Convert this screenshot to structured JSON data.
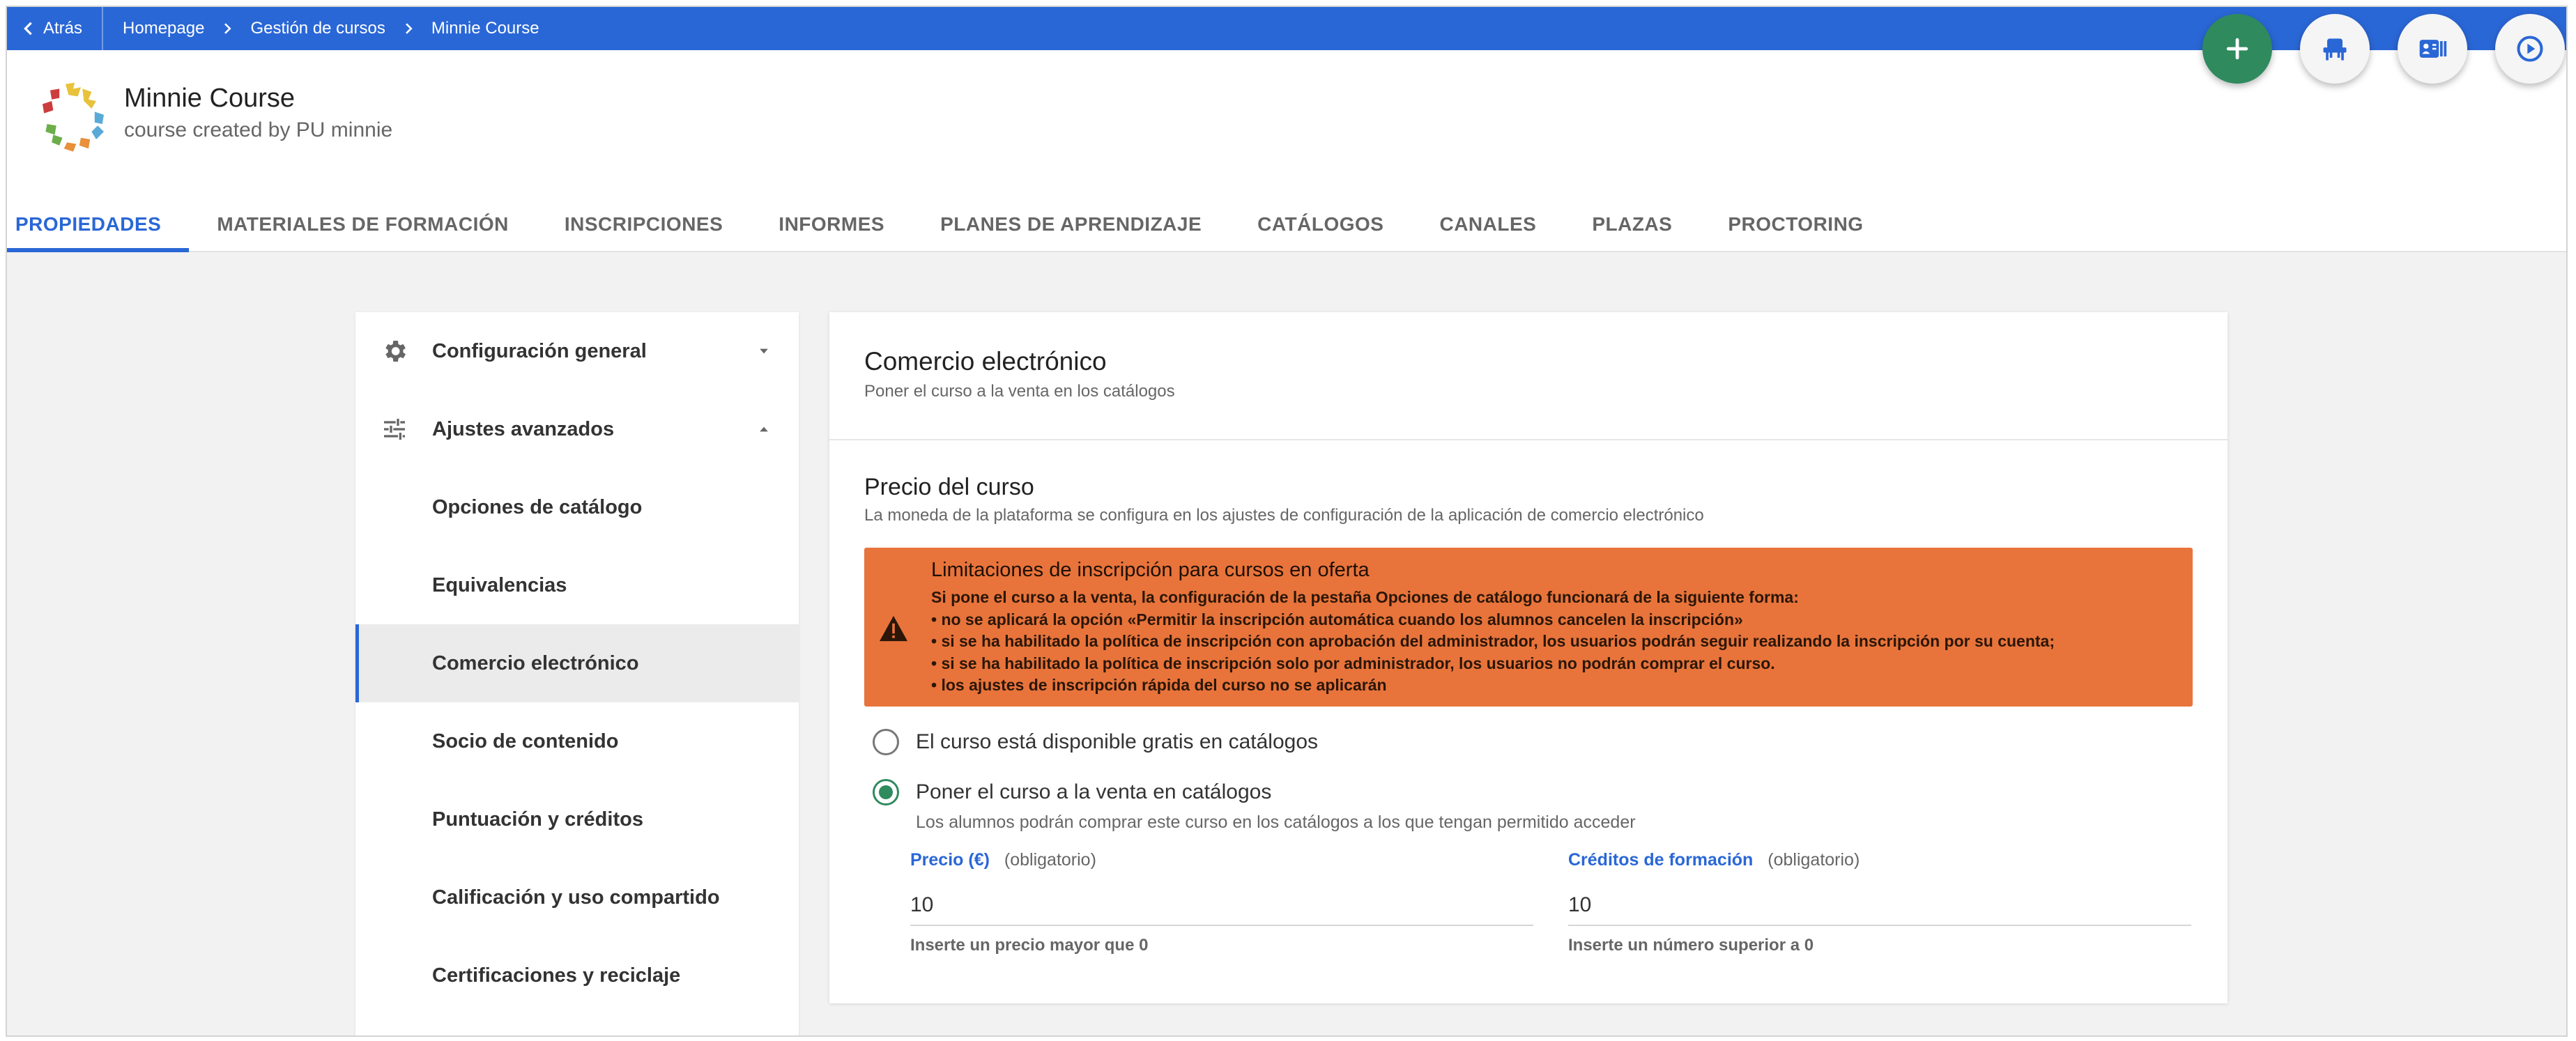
{
  "topbar": {
    "back_label": "Atrás",
    "breadcrumb": [
      "Homepage",
      "Gestión de cursos",
      "Minnie Course"
    ]
  },
  "course": {
    "title": "Minnie Course",
    "subtitle": "course created by PU minnie"
  },
  "colors": {
    "primary": "#2a67d6",
    "success": "#2f8a5e",
    "warning": "#e8743b"
  },
  "fabs": [
    {
      "icon": "plus-icon"
    },
    {
      "icon": "seat-icon"
    },
    {
      "icon": "id-card-icon"
    },
    {
      "icon": "play-circle-icon"
    }
  ],
  "tabs": [
    {
      "label": "PROPIEDADES",
      "active": true
    },
    {
      "label": "MATERIALES DE FORMACIÓN"
    },
    {
      "label": "INSCRIPCIONES"
    },
    {
      "label": "INFORMES"
    },
    {
      "label": "PLANES DE APRENDIZAJE"
    },
    {
      "label": "CATÁLOGOS"
    },
    {
      "label": "CANALES"
    },
    {
      "label": "PLAZAS"
    },
    {
      "label": "PROCTORING"
    }
  ],
  "sidebar": {
    "items": [
      {
        "label": "Configuración general",
        "icon": "gear-icon",
        "chevron": "down"
      },
      {
        "label": "Ajustes avanzados",
        "icon": "sliders-icon",
        "chevron": "up"
      },
      {
        "label": "Opciones de catálogo"
      },
      {
        "label": "Equivalencias"
      },
      {
        "label": "Comercio electrónico",
        "active": true
      },
      {
        "label": "Socio de contenido"
      },
      {
        "label": "Puntuación y créditos"
      },
      {
        "label": "Calificación y uso compartido"
      },
      {
        "label": "Certificaciones y reciclaje"
      }
    ]
  },
  "main": {
    "title": "Comercio electrónico",
    "subtitle": "Poner el curso a la venta en los catálogos",
    "price_section": {
      "title": "Precio del curso",
      "subtitle": "La moneda de la plataforma se configura en los ajustes de configuración de la aplicación de comercio electrónico"
    },
    "warning": {
      "title": "Limitaciones de inscripción para cursos en oferta",
      "lines": [
        "Si pone el curso a la venta, la configuración de la pestaña Opciones de catálogo funcionará de la siguiente forma:",
        "• no se aplicará la opción «Permitir la inscripción automática cuando los alumnos cancelen la inscripción»",
        "• si se ha habilitado la política de inscripción con aprobación del administrador, los usuarios podrán seguir realizando la inscripción por su cuenta;",
        "• si se ha habilitado la política de inscripción solo por administrador, los usuarios no podrán comprar el curso.",
        "• los ajustes de inscripción rápida del curso no se aplicarán"
      ]
    },
    "options": {
      "free_label": "El curso está disponible gratis en catálogos",
      "sale_label": "Poner el curso a la venta en catálogos",
      "sale_description": "Los alumnos podrán comprar este curso en los catálogos a los que tengan permitido acceder",
      "selected": "sale"
    },
    "price_field": {
      "label": "Precio (€)",
      "required": "(obligatorio)",
      "value": "10",
      "hint": "Inserte un precio mayor que 0"
    },
    "credits_field": {
      "label": "Créditos de formación",
      "required": "(obligatorio)",
      "value": "10",
      "hint": "Inserte un número superior a 0"
    }
  }
}
